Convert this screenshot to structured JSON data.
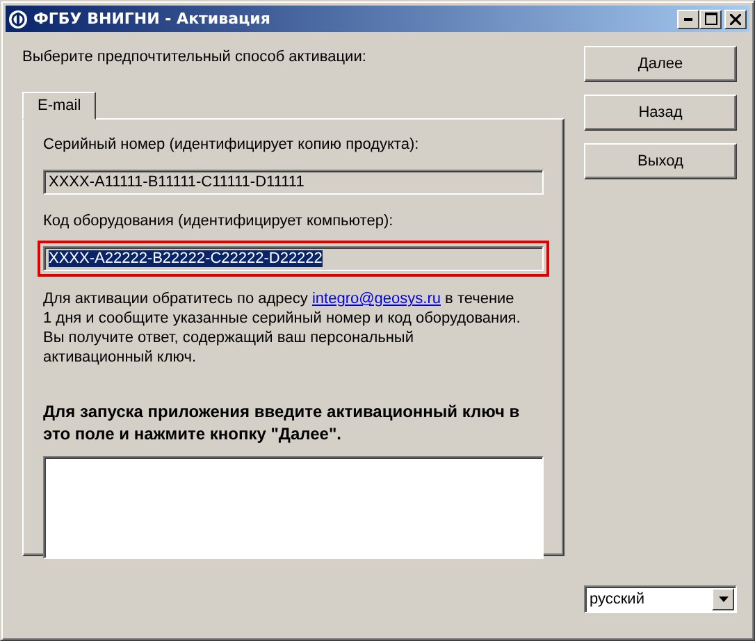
{
  "window": {
    "title": "ФГБУ ВНИГНИ - Активация"
  },
  "prompt": "Выберите предпочтительный способ активации:",
  "tabs": [
    {
      "label": "E-mail",
      "selected": true
    }
  ],
  "fields": [
    {
      "label": "Серийный номер (идентифицирует копию продукта):",
      "value": "XXXX-A11111-B11111-C11111-D11111",
      "text_selected": false,
      "outlined": false
    },
    {
      "label": "Код оборудования (идентифицирует компьютер):",
      "value": "XXXX-A22222-B22222-C22222-D22222",
      "text_selected": true,
      "outlined": true
    }
  ],
  "instructions": {
    "before": "Для активации обратитесь по адресу ",
    "link": "integro@geosys.ru",
    "after": " в течение 1 дня и сообщите указанные серийный номер и код оборудования. Вы получите ответ, содержащий ваш персональный активационный ключ."
  },
  "key_prompt": "Для запуска приложения введите активационный ключ в это поле и нажмите кнопку \"Далее\".",
  "buttons": [
    "Далее",
    "Назад",
    "Выход"
  ],
  "language": {
    "value": "русский"
  }
}
